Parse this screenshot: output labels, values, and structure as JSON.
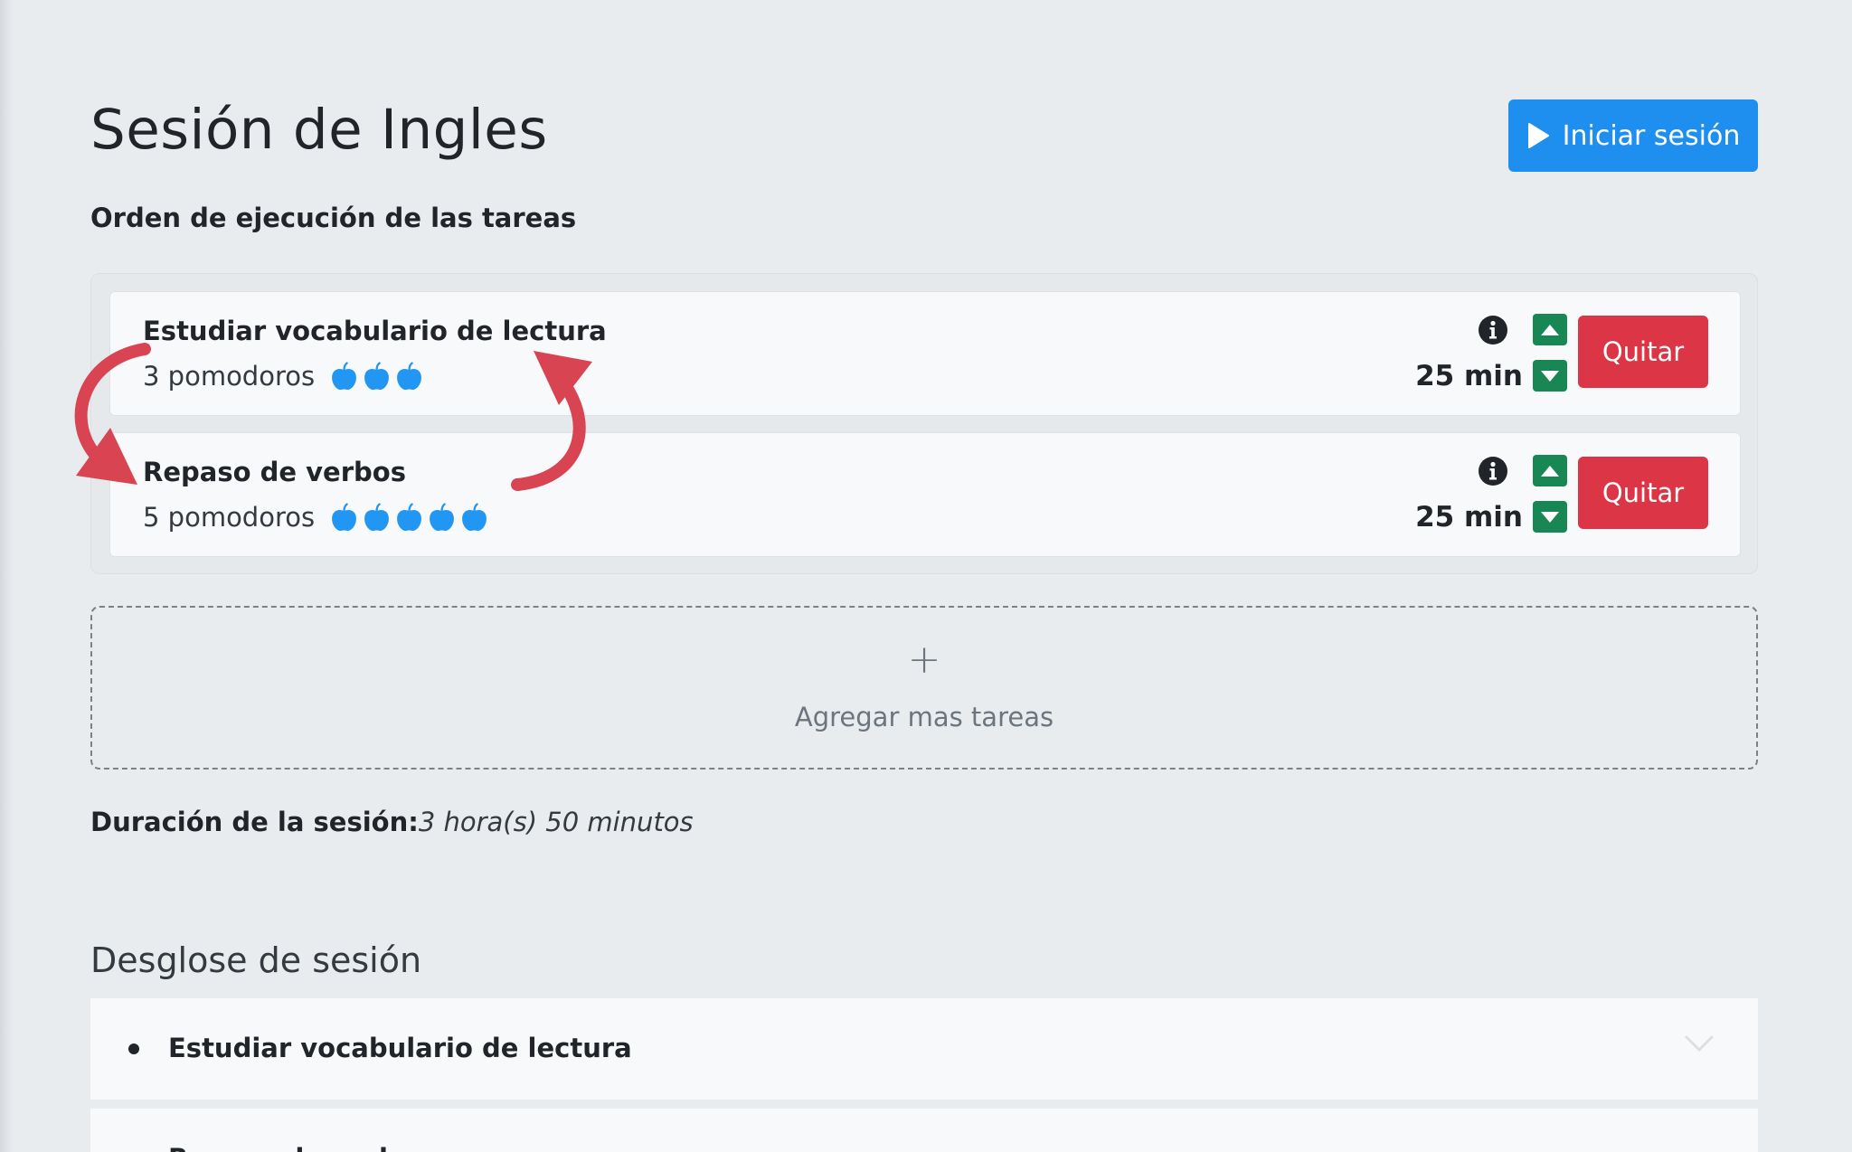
{
  "header": {
    "title": "Sesión de Ingles",
    "start_button_label": "Iniciar sesión"
  },
  "order_section": {
    "subtitle": "Orden de ejecución de las tareas"
  },
  "tasks": [
    {
      "name": "Estudiar vocabulario de lectura",
      "pomodoros_label": "3 pomodoros",
      "pomodoro_count": 3,
      "duration": "25 min",
      "remove_label": "Quitar"
    },
    {
      "name": "Repaso de verbos",
      "pomodoros_label": "5 pomodoros",
      "pomodoro_count": 5,
      "duration": "25 min",
      "remove_label": "Quitar"
    }
  ],
  "add_tasks": {
    "icon": "plus-icon",
    "label": "Agregar mas tareas"
  },
  "session": {
    "duration_label": "Duración de la sesión:",
    "duration_value": "3 hora(s) 50 minutos"
  },
  "breakdown": {
    "title": "Desglose de sesión",
    "items": [
      {
        "label": "Estudiar vocabulario de lectura"
      },
      {
        "label": "Repaso de verbos"
      }
    ]
  },
  "icons": {
    "start": "play-icon",
    "info": "info-circle-icon",
    "move_up": "caret-up-icon",
    "move_down": "caret-down-icon",
    "pomodoro": "apple-icon",
    "expand": "chevron-down-icon",
    "reorder": "swap-arrows-icon"
  },
  "colors": {
    "background": "#e9ecef",
    "primary": "#1e8fef",
    "success": "#198754",
    "danger": "#dc3545",
    "apple": "#2196f3",
    "annotation": "#d94452"
  }
}
